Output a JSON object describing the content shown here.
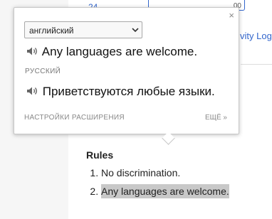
{
  "page": {
    "top_link_fragment": "24",
    "edit_fragment": "00",
    "activity_log": "vity Log",
    "rules": {
      "heading": "Rules",
      "items": [
        "No discrimination.",
        "Any languages are welcome."
      ]
    }
  },
  "popup": {
    "close": "×",
    "source_language": "английский",
    "source_text": "Any languages are welcome.",
    "target_language": "РУССКИЙ",
    "target_text": "Приветствуются любые языки.",
    "settings_label": "НАСТРОЙКИ РАСШИРЕНИЯ",
    "more_label": "ЕЩЁ »"
  },
  "icons": {
    "speaker": "speaker-icon",
    "close": "close-icon",
    "dropdown": "chevron-down-icon"
  },
  "colors": {
    "link": "#3366cc",
    "highlight": "#c8c8c8",
    "muted": "#888888"
  }
}
